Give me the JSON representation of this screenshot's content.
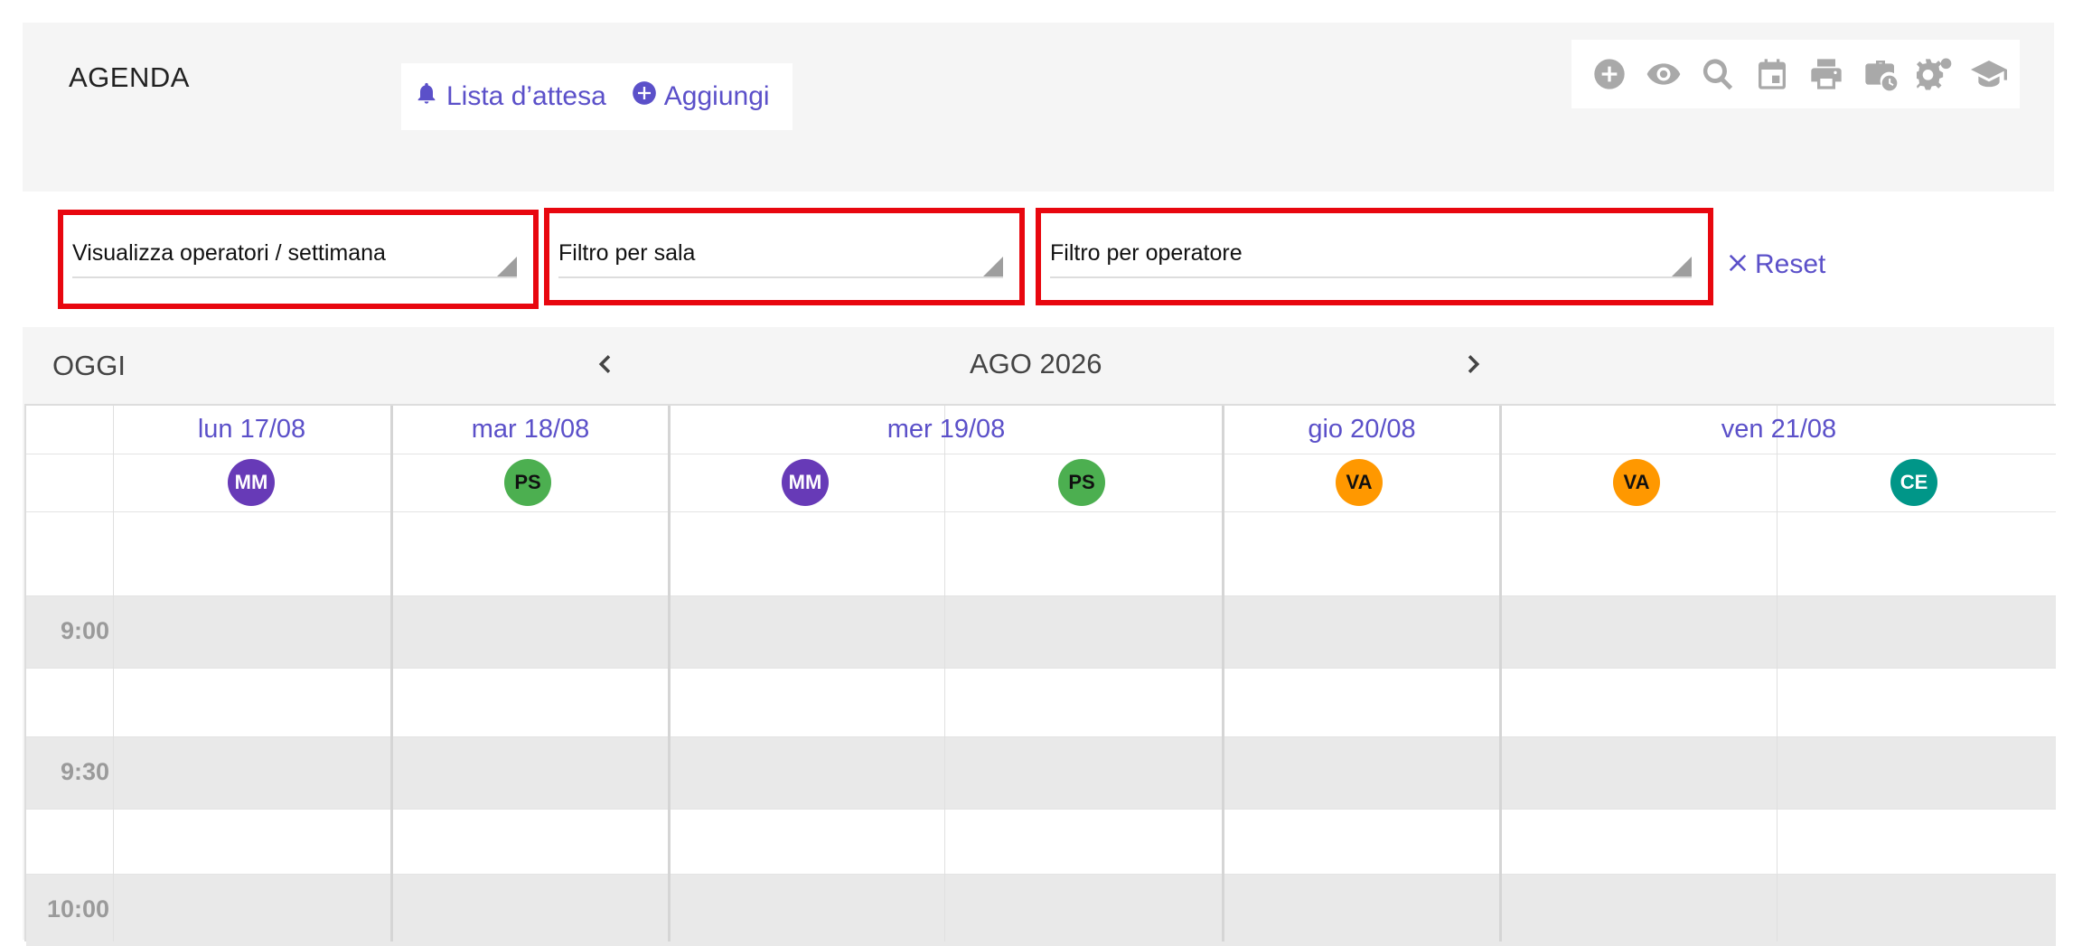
{
  "header": {
    "title": "AGENDA",
    "waitlist_label": "Lista d’attesa",
    "add_label": "Aggiungi"
  },
  "toolbar": {
    "icons": [
      "add-circle-icon",
      "eye-icon",
      "search-icon",
      "calendar-icon",
      "print-icon",
      "briefcase-clock-icon",
      "gears-icon",
      "graduation-cap-icon"
    ]
  },
  "filters": {
    "view": "Visualizza operatori / settimana",
    "room": "Filtro per sala",
    "operator": "Filtro per operatore",
    "reset_label": "Reset"
  },
  "nav": {
    "today_label": "OGGI",
    "month_label": "AGO 2026"
  },
  "days": [
    {
      "label": "lun 17/08"
    },
    {
      "label": "mar 18/08"
    },
    {
      "label": "mer 19/08"
    },
    {
      "label": "gio 20/08"
    },
    {
      "label": "ven 21/08"
    }
  ],
  "operators": [
    {
      "initials": "MM",
      "color": "#673ab7",
      "text_color": "#ffffff"
    },
    {
      "initials": "PS",
      "color": "#4caf50",
      "text_color": "#111111"
    },
    {
      "initials": "MM",
      "color": "#673ab7",
      "text_color": "#ffffff"
    },
    {
      "initials": "PS",
      "color": "#4caf50",
      "text_color": "#111111"
    },
    {
      "initials": "VA",
      "color": "#ff9800",
      "text_color": "#111111"
    },
    {
      "initials": "VA",
      "color": "#ff9800",
      "text_color": "#111111"
    },
    {
      "initials": "CE",
      "color": "#009688",
      "text_color": "#ffffff"
    }
  ],
  "times": [
    "9:00",
    "9:30",
    "10:00"
  ],
  "colors": {
    "accent": "#5b50c9",
    "highlight": "#e8070f"
  }
}
